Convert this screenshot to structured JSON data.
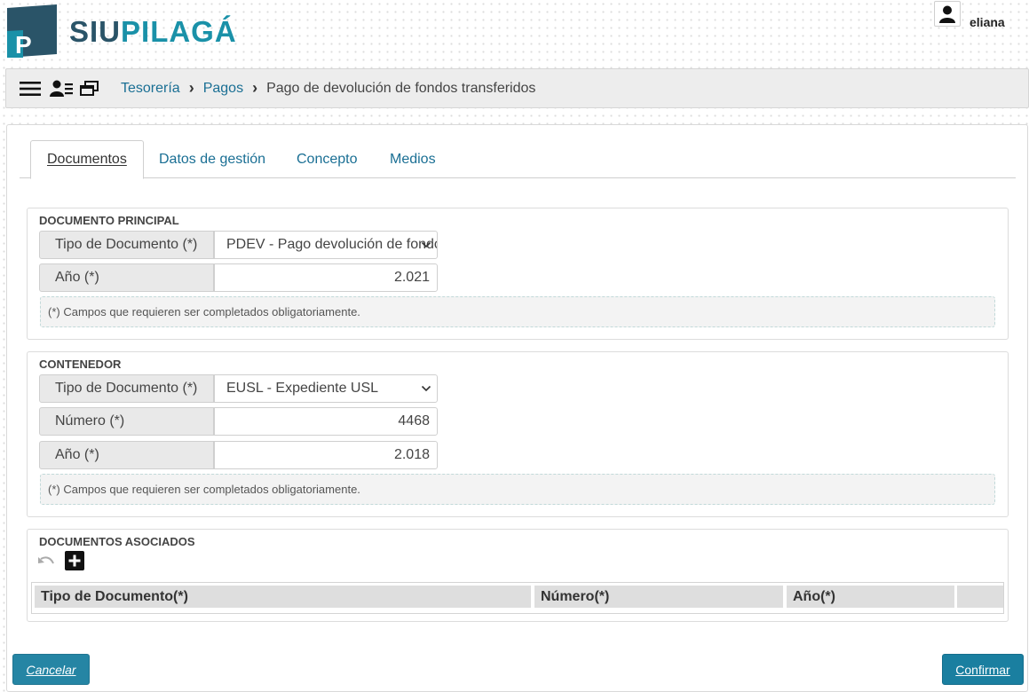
{
  "header": {
    "logo_part1": "SIU",
    "logo_part2": "PILAGÁ",
    "logo_letter": "P",
    "username": "eliana"
  },
  "toolbar": {
    "icons": [
      "menu-icon",
      "user-list-icon",
      "windows-icon"
    ],
    "breadcrumb": [
      {
        "label": "Tesorería",
        "link": true
      },
      {
        "label": "Pagos",
        "link": true
      },
      {
        "label": "Pago de devolución de fondos transferidos",
        "link": false
      }
    ],
    "separator": "›"
  },
  "tabs": [
    {
      "label": "Documentos",
      "active": true
    },
    {
      "label": "Datos de gestión",
      "active": false
    },
    {
      "label": "Concepto",
      "active": false
    },
    {
      "label": "Medios",
      "active": false
    }
  ],
  "documento_principal": {
    "title": "DOCUMENTO PRINCIPAL",
    "tipo_label": "Tipo de Documento (*)",
    "tipo_value": "PDEV - Pago devolución de fondos transferidos",
    "anio_label": "Año (*)",
    "anio_value": "2.021",
    "note": "(*) Campos que requieren ser completados obligatoriamente."
  },
  "contenedor": {
    "title": "CONTENEDOR",
    "tipo_label": "Tipo de Documento (*)",
    "tipo_value": "EUSL - Expediente USL",
    "numero_label": "Número (*)",
    "numero_value": "4468",
    "anio_label": "Año (*)",
    "anio_value": "2.018",
    "note": "(*) Campos que requieren ser completados obligatoriamente."
  },
  "documentos_asociados": {
    "title": "DOCUMENTOS ASOCIADOS",
    "columns": [
      "Tipo de Documento(*)",
      "Número(*)",
      "Año(*)",
      ""
    ]
  },
  "footer": {
    "cancel_label": "Cancelar",
    "confirm_label": "Confirmar"
  },
  "colors": {
    "accent": "#1a7fa0",
    "link": "#1a6f94",
    "logo_dark": "#2a5468",
    "logo_light": "#1a91a8"
  }
}
